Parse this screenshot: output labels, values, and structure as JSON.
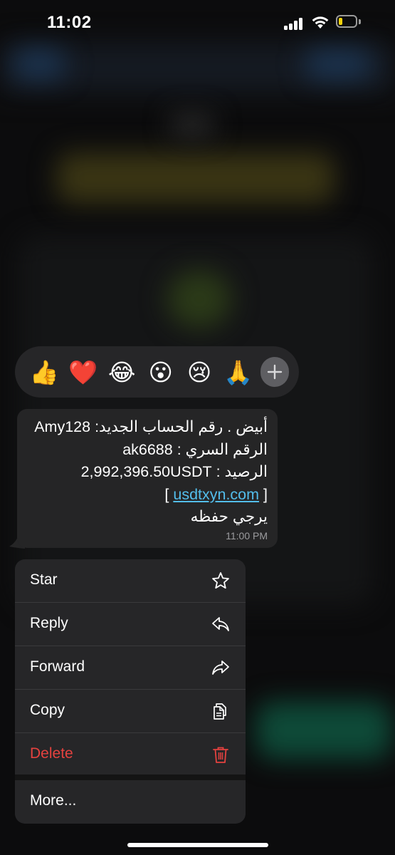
{
  "status_bar": {
    "time": "11:02"
  },
  "reactions": [
    {
      "emoji": "👍",
      "name": "thumbs-up"
    },
    {
      "emoji": "❤️",
      "name": "heart"
    },
    {
      "emoji": "😂",
      "name": "laughing"
    },
    {
      "emoji": "😮",
      "name": "surprised"
    },
    {
      "emoji": "😢",
      "name": "crying"
    },
    {
      "emoji": "🙏",
      "name": "praying-hands"
    }
  ],
  "message": {
    "line1": "أبيض . رقم الحساب الجديد: Amy128",
    "line2": "الرقم السري : ak6688",
    "line3": "الرصيد : 2,992,396.50USDT",
    "line4_bracket_open": "[ ",
    "line4_link": "usdtxyn.com",
    "line4_bracket_close": " ]",
    "line5": "يرجي  حفظه",
    "time": "11:00 PM"
  },
  "menu": {
    "items": [
      {
        "label": "Star",
        "icon": "star-icon"
      },
      {
        "label": "Reply",
        "icon": "reply-icon"
      },
      {
        "label": "Forward",
        "icon": "forward-icon"
      },
      {
        "label": "Copy",
        "icon": "copy-icon"
      },
      {
        "label": "Delete",
        "icon": "trash-icon"
      },
      {
        "label": "More..."
      }
    ],
    "danger_color": "#e5423f"
  },
  "colors": {
    "link": "#53bdeb",
    "battery_fill": "#f5d30b"
  }
}
